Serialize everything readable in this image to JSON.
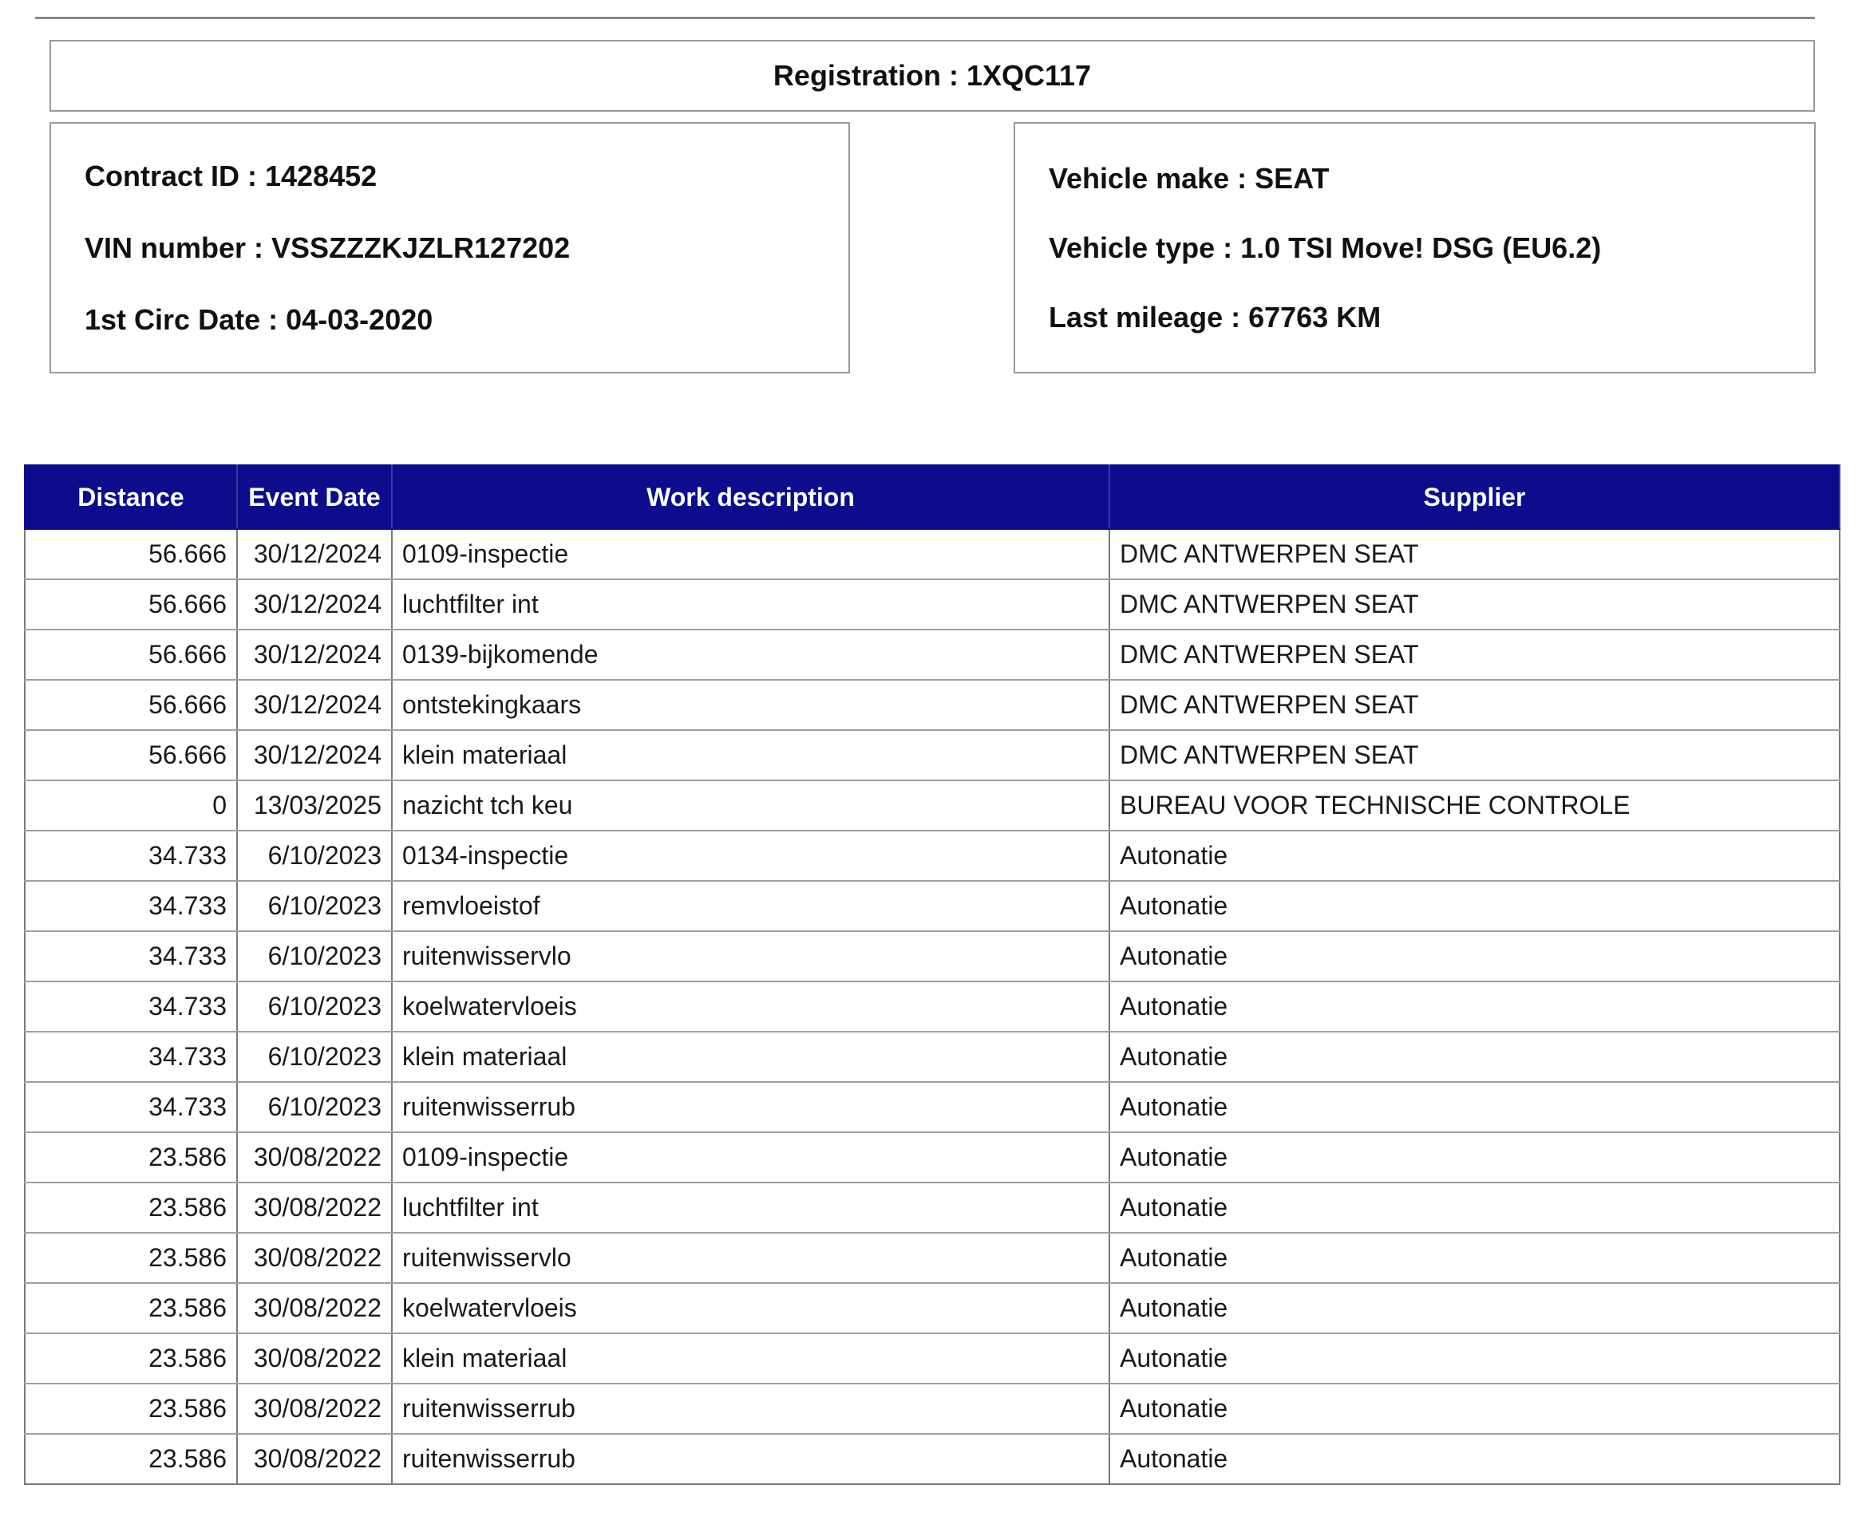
{
  "registration": {
    "label": "Registration",
    "value": "1XQC117"
  },
  "left_info": [
    {
      "label": "Contract ID",
      "value": "1428452"
    },
    {
      "label": "VIN number",
      "value": "VSSZZZKJZLR127202"
    },
    {
      "label": "1st Circ Date",
      "value": "04-03-2020"
    }
  ],
  "right_info": [
    {
      "label": "Vehicle make",
      "value": "SEAT"
    },
    {
      "label": "Vehicle type",
      "value": "1.0 TSI Move! DSG (EU6.2)"
    },
    {
      "label": "Last mileage",
      "value": "67763 KM"
    }
  ],
  "table": {
    "columns": [
      "Distance",
      "Event Date",
      "Work description",
      "Supplier"
    ],
    "rows": [
      [
        "56.666",
        "30/12/2024",
        "0109-inspectie",
        "DMC ANTWERPEN SEAT"
      ],
      [
        "56.666",
        "30/12/2024",
        "luchtfilter int",
        "DMC ANTWERPEN SEAT"
      ],
      [
        "56.666",
        "30/12/2024",
        "0139-bijkomende",
        "DMC ANTWERPEN SEAT"
      ],
      [
        "56.666",
        "30/12/2024",
        "ontstekingkaars",
        "DMC ANTWERPEN SEAT"
      ],
      [
        "56.666",
        "30/12/2024",
        "klein materiaal",
        "DMC ANTWERPEN SEAT"
      ],
      [
        "0",
        "13/03/2025",
        "nazicht tch keu",
        "BUREAU VOOR TECHNISCHE CONTROLE"
      ],
      [
        "34.733",
        "6/10/2023",
        "0134-inspectie",
        "Autonatie"
      ],
      [
        "34.733",
        "6/10/2023",
        "remvloeistof",
        "Autonatie"
      ],
      [
        "34.733",
        "6/10/2023",
        "ruitenwisservlo",
        "Autonatie"
      ],
      [
        "34.733",
        "6/10/2023",
        "koelwatervloeis",
        "Autonatie"
      ],
      [
        "34.733",
        "6/10/2023",
        "klein materiaal",
        "Autonatie"
      ],
      [
        "34.733",
        "6/10/2023",
        "ruitenwisserrub",
        "Autonatie"
      ],
      [
        "23.586",
        "30/08/2022",
        "0109-inspectie",
        "Autonatie"
      ],
      [
        "23.586",
        "30/08/2022",
        "luchtfilter int",
        "Autonatie"
      ],
      [
        "23.586",
        "30/08/2022",
        "ruitenwisservlo",
        "Autonatie"
      ],
      [
        "23.586",
        "30/08/2022",
        "koelwatervloeis",
        "Autonatie"
      ],
      [
        "23.586",
        "30/08/2022",
        "klein materiaal",
        "Autonatie"
      ],
      [
        "23.586",
        "30/08/2022",
        "ruitenwisserrub",
        "Autonatie"
      ],
      [
        "23.586",
        "30/08/2022",
        "ruitenwisserrub",
        "Autonatie"
      ]
    ]
  }
}
